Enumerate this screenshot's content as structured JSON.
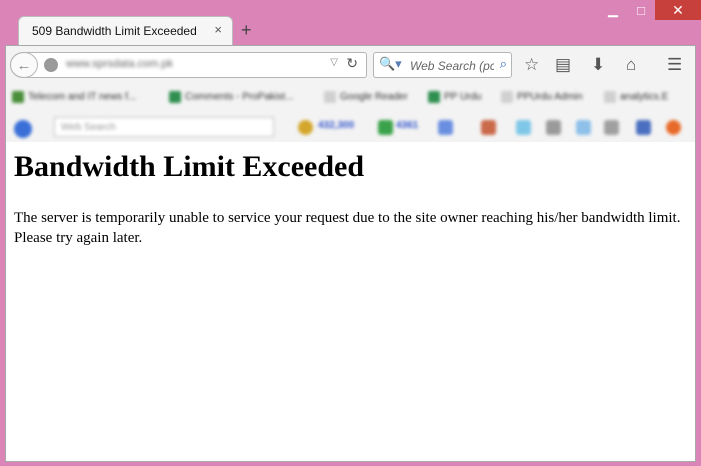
{
  "window": {
    "minimize_glyph": "▁",
    "maximize_glyph": "□",
    "close_glyph": "✕"
  },
  "tab": {
    "title": "509 Bandwidth Limit Exceeded",
    "close_glyph": "×",
    "new_tab_glyph": "+"
  },
  "navbar": {
    "back_glyph": "←",
    "url": "www.sprsdata.com.pk",
    "dropdown_glyph": "▽",
    "reload_glyph": "↻",
    "search_engine_glyph": "🔍▾",
    "search_placeholder": "Web Search (pc",
    "search_go_glyph": "⌕",
    "icons": {
      "bookmark_star": "☆",
      "reading_list": "▤",
      "downloads": "⬇",
      "home": "⌂",
      "menu": "☰"
    }
  },
  "bookmarks": [
    {
      "label": "Telecom and IT news f...",
      "color": "#4a8f3a"
    },
    {
      "label": "Comments - ProPakist...",
      "color": "#2f8f4f"
    },
    {
      "label": "Google Reader",
      "color": "#d0d0d0"
    },
    {
      "label": "PP Urdu",
      "color": "#2f8f4f"
    },
    {
      "label": "PPUrdu Admin",
      "color": "#d0d0d0"
    },
    {
      "label": "analytics.E",
      "color": "#d0d0d0"
    }
  ],
  "addons": {
    "search_placeholder": "Web Search",
    "count_a": "432,300",
    "count_b": "4361"
  },
  "page": {
    "heading": "Bandwidth Limit Exceeded",
    "body": "The server is temporarily unable to service your request due to the site owner reaching his/her bandwidth limit. Please try again later."
  }
}
